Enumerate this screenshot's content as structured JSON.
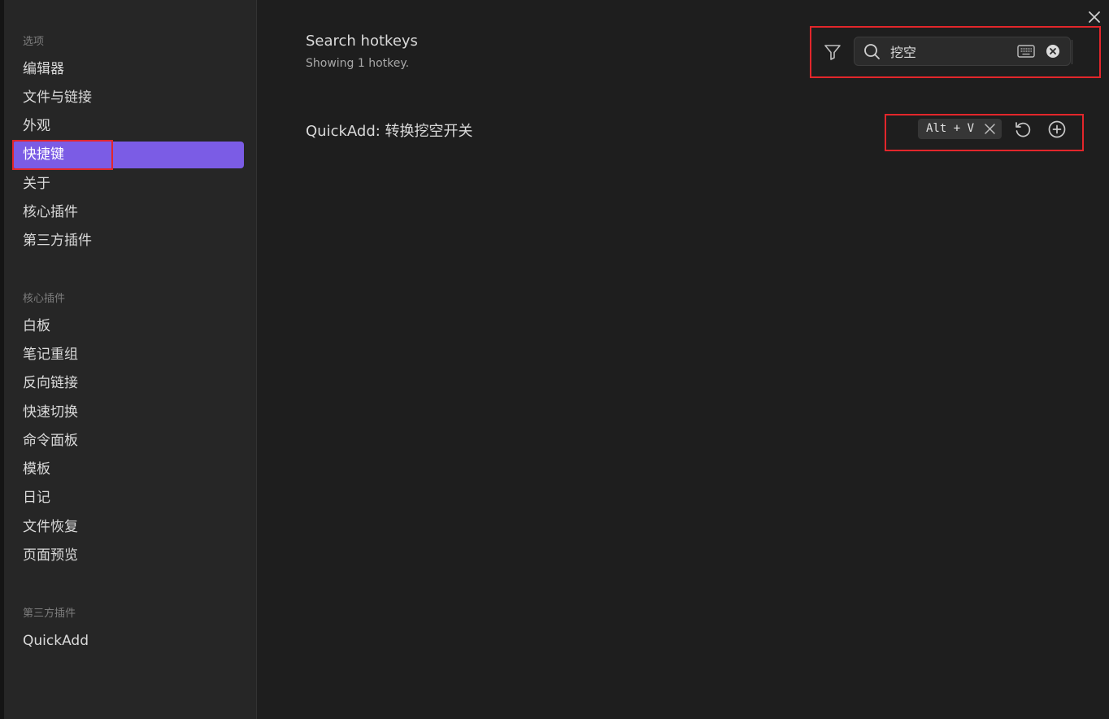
{
  "sidebar": {
    "sections": [
      {
        "title": "选项",
        "items": [
          "编辑器",
          "文件与链接",
          "外观",
          "快捷键",
          "关于",
          "核心插件",
          "第三方插件"
        ]
      },
      {
        "title": "核心插件",
        "items": [
          "白板",
          "笔记重组",
          "反向链接",
          "快速切换",
          "命令面板",
          "模板",
          "日记",
          "文件恢复",
          "页面预览"
        ]
      },
      {
        "title": "第三方插件",
        "items": [
          "QuickAdd"
        ]
      }
    ],
    "active_item": "快捷键"
  },
  "main": {
    "heading": "Search hotkeys",
    "subheading": "Showing 1 hotkey.",
    "search": {
      "value": "挖空",
      "placeholder": ""
    },
    "hotkeys": [
      {
        "name": "QuickAdd: 转换挖空开关",
        "binding": "Alt + V"
      }
    ]
  },
  "icons": {
    "close": "close-icon",
    "filter": "filter-icon",
    "search": "search-icon",
    "keyboard": "keyboard-icon",
    "clear": "clear-search-icon",
    "restore": "restore-default-icon",
    "add": "add-hotkey-icon"
  },
  "colors": {
    "accent": "#7b5ce5",
    "highlight": "#e2262b",
    "background": "#1e1e1e",
    "sidebar": "#262626"
  }
}
